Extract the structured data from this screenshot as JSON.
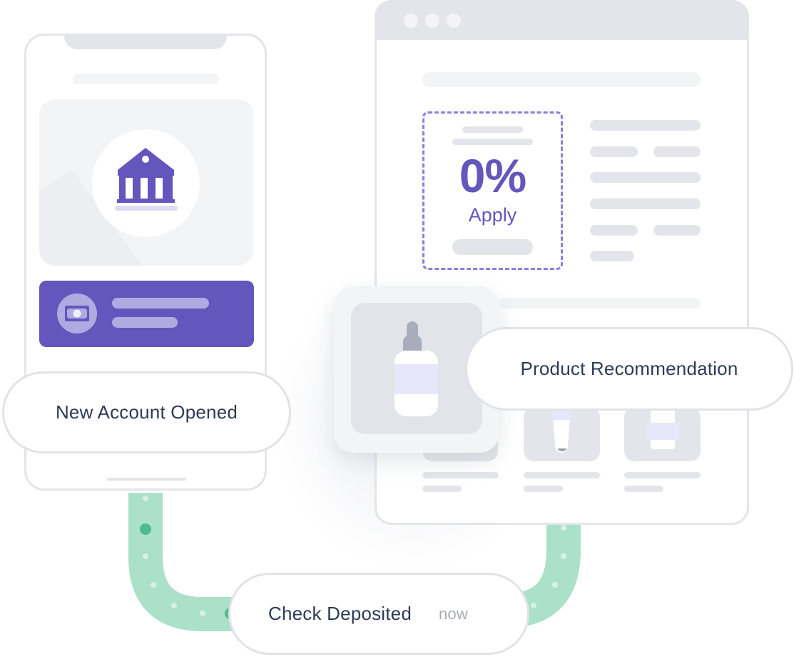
{
  "phone": {
    "icons": {
      "hero": "bank-icon",
      "card": "money-icon"
    }
  },
  "events": {
    "new_account": "New Account Opened",
    "check_deposited": "Check Deposited",
    "check_deposited_time": "now",
    "product_recommendation": "Product Recommendation"
  },
  "browser": {
    "offer": {
      "value": "0%",
      "cta": "Apply"
    },
    "product_icon": "serum-bottle-icon"
  },
  "colors": {
    "accent_purple": "#6456bd",
    "dashed_border": "#8e7ddc",
    "path_green": "#abe0c9",
    "dot_green": "#4dbb8b",
    "text_dark": "#2e3b56",
    "text_muted": "#a9abb8",
    "placeholder_gray": "#e4e5ea"
  }
}
